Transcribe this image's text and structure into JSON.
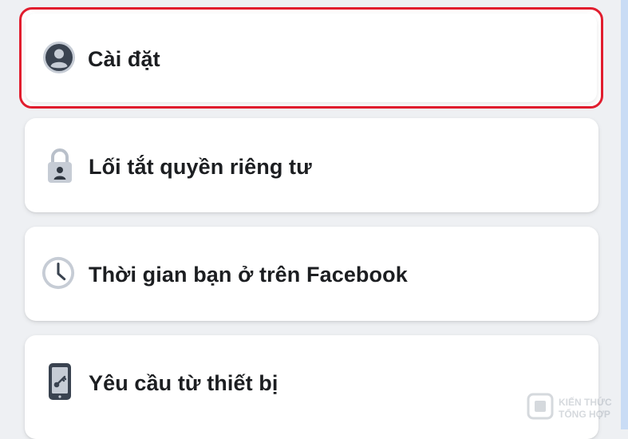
{
  "menu": {
    "items": [
      {
        "label": "Cài đặt",
        "icon": "profile-icon",
        "highlighted": true
      },
      {
        "label": "Lối tắt quyền riêng tư",
        "icon": "lock-person-icon",
        "highlighted": false
      },
      {
        "label": "Thời gian bạn ở trên Facebook",
        "icon": "clock-icon",
        "highlighted": false
      },
      {
        "label": "Yêu cầu từ thiết bị",
        "icon": "phone-key-icon",
        "highlighted": false
      }
    ]
  },
  "watermark": {
    "line1": "KIẾN THỨC",
    "line2": "TỔNG HỢP"
  },
  "colors": {
    "background": "#eef0f3",
    "card": "#ffffff",
    "highlight_border": "#e11d2e",
    "text": "#1c1e21",
    "icon_dark": "#3a4350",
    "icon_light": "#c6ccd5",
    "right_rail": "#c9dcf5"
  }
}
